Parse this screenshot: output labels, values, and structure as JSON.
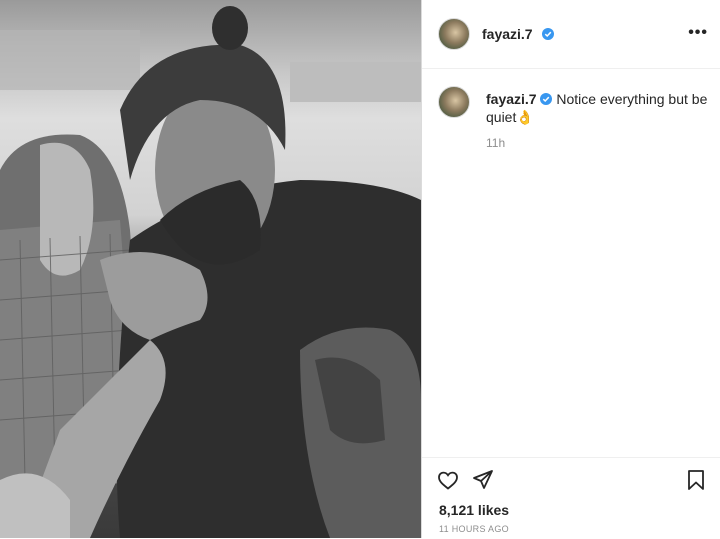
{
  "post": {
    "username": "fayazi.7",
    "verified": true,
    "caption": "Notice everything but be quiet",
    "caption_emoji": "👌",
    "comment_time": "11h",
    "likes": "8,121 likes",
    "posted_ago": "11 HOURS AGO"
  },
  "icons": {
    "more": "more-options-icon",
    "like": "heart-icon",
    "share": "paper-plane-icon",
    "save": "bookmark-icon",
    "verified": "verified-badge-icon"
  },
  "colors": {
    "verified": "#3897f0",
    "muted": "#8e8e8e",
    "text": "#262626"
  }
}
